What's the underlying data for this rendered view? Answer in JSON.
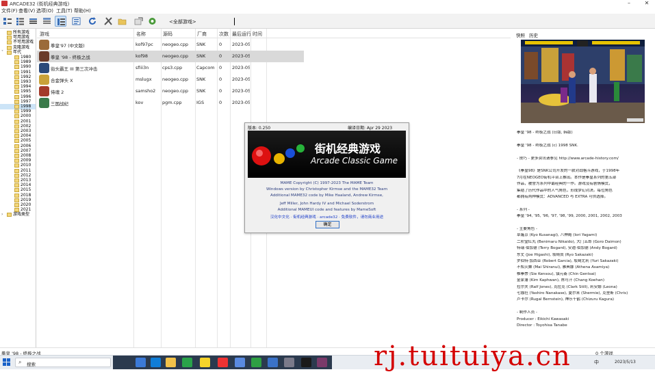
{
  "window": {
    "title": "ARCADE32 (街机经典游戏)",
    "min_label": "–",
    "close_label": "✕"
  },
  "menu": [
    "文件(F)",
    "查看(V)",
    "选项(O)",
    "工具(T)",
    "帮助(H)"
  ],
  "filter": {
    "value": "<全部游戏>"
  },
  "toolbar": {
    "icons": [
      "list-large-icon",
      "list-small-icon",
      "list-icon",
      "grouped-icon",
      "details-icon",
      "tree-icon",
      "refresh-icon",
      "tools-icon",
      "folder-icon",
      "export-icon",
      "settings-icon"
    ]
  },
  "tree": [
    {
      "label": "所有游戏",
      "level": 0
    },
    {
      "label": "可用游戏",
      "level": 0
    },
    {
      "label": "不可用游戏",
      "level": 0
    },
    {
      "label": "克隆游戏",
      "level": 0
    },
    {
      "label": "年代",
      "level": 0,
      "expanded": true
    },
    {
      "label": "1980",
      "level": 1
    },
    {
      "label": "1989",
      "level": 1
    },
    {
      "label": "1990",
      "level": 1
    },
    {
      "label": "1991",
      "level": 1
    },
    {
      "label": "1992",
      "level": 1
    },
    {
      "label": "1993",
      "level": 1
    },
    {
      "label": "1994",
      "level": 1
    },
    {
      "label": "1995",
      "level": 1
    },
    {
      "label": "1996",
      "level": 1
    },
    {
      "label": "1997",
      "level": 1
    },
    {
      "label": "1998",
      "level": 1,
      "selected": true
    },
    {
      "label": "1999",
      "level": 1
    },
    {
      "label": "2000",
      "level": 1
    },
    {
      "label": "2001",
      "level": 1
    },
    {
      "label": "2002",
      "level": 1
    },
    {
      "label": "2003",
      "level": 1
    },
    {
      "label": "2004",
      "level": 1
    },
    {
      "label": "2005",
      "level": 1
    },
    {
      "label": "2006",
      "level": 1
    },
    {
      "label": "2007",
      "level": 1
    },
    {
      "label": "2008",
      "level": 1
    },
    {
      "label": "2009",
      "level": 1
    },
    {
      "label": "2010",
      "level": 1
    },
    {
      "label": "2011",
      "level": 1
    },
    {
      "label": "2012",
      "level": 1
    },
    {
      "label": "2013",
      "level": 1
    },
    {
      "label": "2014",
      "level": 1
    },
    {
      "label": "2015",
      "level": 1
    },
    {
      "label": "2018",
      "level": 1
    },
    {
      "label": "2019",
      "level": 1
    },
    {
      "label": "2020",
      "level": 1
    },
    {
      "label": "2021",
      "level": 1
    },
    {
      "label": "游戏类型",
      "level": 0,
      "collapsed": true
    }
  ],
  "table": {
    "columns": [
      "游戏",
      "名称",
      "源码",
      "厂商",
      "次数",
      "最后运行",
      "时间"
    ],
    "rows": [
      {
        "game": "拳皇'97 (中文版)",
        "name": "kof97pc",
        "source": "neogeo.cpp",
        "maker": "SNK",
        "plays": "0",
        "last": "2023-05",
        "time": "",
        "color": "#9b6b3a"
      },
      {
        "game": "拳皇 '98 - 终极之战",
        "name": "kof98",
        "source": "neogeo.cpp",
        "maker": "SNK",
        "plays": "0",
        "last": "2023-05",
        "time": "",
        "color": "#6a3b2a"
      },
      {
        "game": "街头霸王 III 第三次冲击",
        "name": "sfiii3n",
        "source": "cps3.cpp",
        "maker": "Capcom",
        "plays": "0",
        "last": "2023-05",
        "time": "",
        "color": "#2b4a7a"
      },
      {
        "game": "合金弹头 X",
        "name": "mslugx",
        "source": "neogeo.cpp",
        "maker": "SNK",
        "plays": "0",
        "last": "2023-05",
        "time": "",
        "color": "#c9a23a"
      },
      {
        "game": "侍魂 2",
        "name": "samsho2",
        "source": "neogeo.cpp",
        "maker": "SNK",
        "plays": "0",
        "last": "2023-05",
        "time": "",
        "color": "#a33a2a"
      },
      {
        "game": "三国战纪",
        "name": "kov",
        "source": "pgm.cpp",
        "maker": "IGS",
        "plays": "0",
        "last": "2023-05",
        "time": "",
        "color": "#3a7a4a"
      }
    ]
  },
  "dialog": {
    "version": "版本: 0.250",
    "build_date": "编译日期: Apr 29 2023  12:36:36",
    "logo_cn": "街机经典游戏",
    "logo_en": "Arcade Classic Game",
    "lines": [
      "MAME Copyright (C) 1997-2023 The MAME Team",
      "Windows version by Christopher Kirmse and the MAME32 Team",
      "Additional MAME32 code by Mike Haaland, Andrew Kirmse,",
      "Jeff Miller, John Hardy IV and Michael Soderstrom",
      "Additional MAMEUI code and features by MameSoft",
      "汉化中文化 · 街机经典游戏 · arcade32 · 免费软件，请勿商业用途"
    ],
    "ok_label": "确定"
  },
  "right_panel": {
    "tabs": [
      "快照",
      "历史"
    ],
    "info": [
      "拳皇 '98 - 终极之战 (日版, 韩版)",
      "",
      "拳皇 '98 - 终极之战 (c) 1998 SNK.",
      "",
      "- 技巧 - 更多资讯请参见 http://www.arcade-history.com/",
      "",
      "《拳皇98》是SNK公司开发的一款对战格斗游戏，于1998年",
      "7月在NEOGEO街机平台上推出。本作是拳皇系列的第五部",
      "作品，被誉为系列中最经典的一作。游戏没有剧情模式，",
      "集结了历代作品中的人气角色，形成梦幻对决。每位角色",
      "都拥有两种模式：ADVANCED 与 EXTRA 可供选择。",
      "",
      "- 系列 -",
      "拳皇 '94, '95, '96, '97, '98, '99, 2000, 2001, 2002, 2003",
      "",
      "- 主要角色 -",
      "草薙京 (Kyo Kusanagi), 八神庵 (Iori Yagami)",
      "二阶堂红丸 (Benimaru Nikaido), 大门五郎 (Goro Daimon)",
      "特瑞·伯加德 (Terry Bogard), 安迪·伯加德 (Andy Bogard)",
      "东丈 (Joe Higashi), 坂崎良 (Ryo Sakazaki)",
      "罗伯特·加西亚 (Robert Garcia), 坂崎尤莉 (Yuri Sakazaki)",
      "不知火舞 (Mai Shiranui), 雅典娜 (Athena Asamiya)",
      "椎拳崇 (Sie Kensou), 镇元斋 (Chin Gentsai)",
      "金家藩 (Kim Kaphwan), 陈可汗 (Chang Koehan)",
      "拉尔夫 (Ralf Jones), 克拉克 (Clark Still), 莉安娜 (Leona)",
      "七枷社 (Yashiro Nanakase), 夏尔米 (Shermie), 克里斯 (Chris)",
      "卢卡尔 (Rugal Bernstein), 神乐千鹤 (Chizuru Kagura)",
      "",
      "- 制作人员 -",
      "Producer : Eikichi Kawasaki",
      "Director : Toyohisa Tanabe"
    ]
  },
  "status": {
    "left": "拳皇 '98 - 终极之战",
    "right": "0 个游戏"
  },
  "taskbar": {
    "search_label": "搜索",
    "tray": "中",
    "clock": "2023/5/13"
  },
  "watermark": "rj.tuituiya.cn"
}
